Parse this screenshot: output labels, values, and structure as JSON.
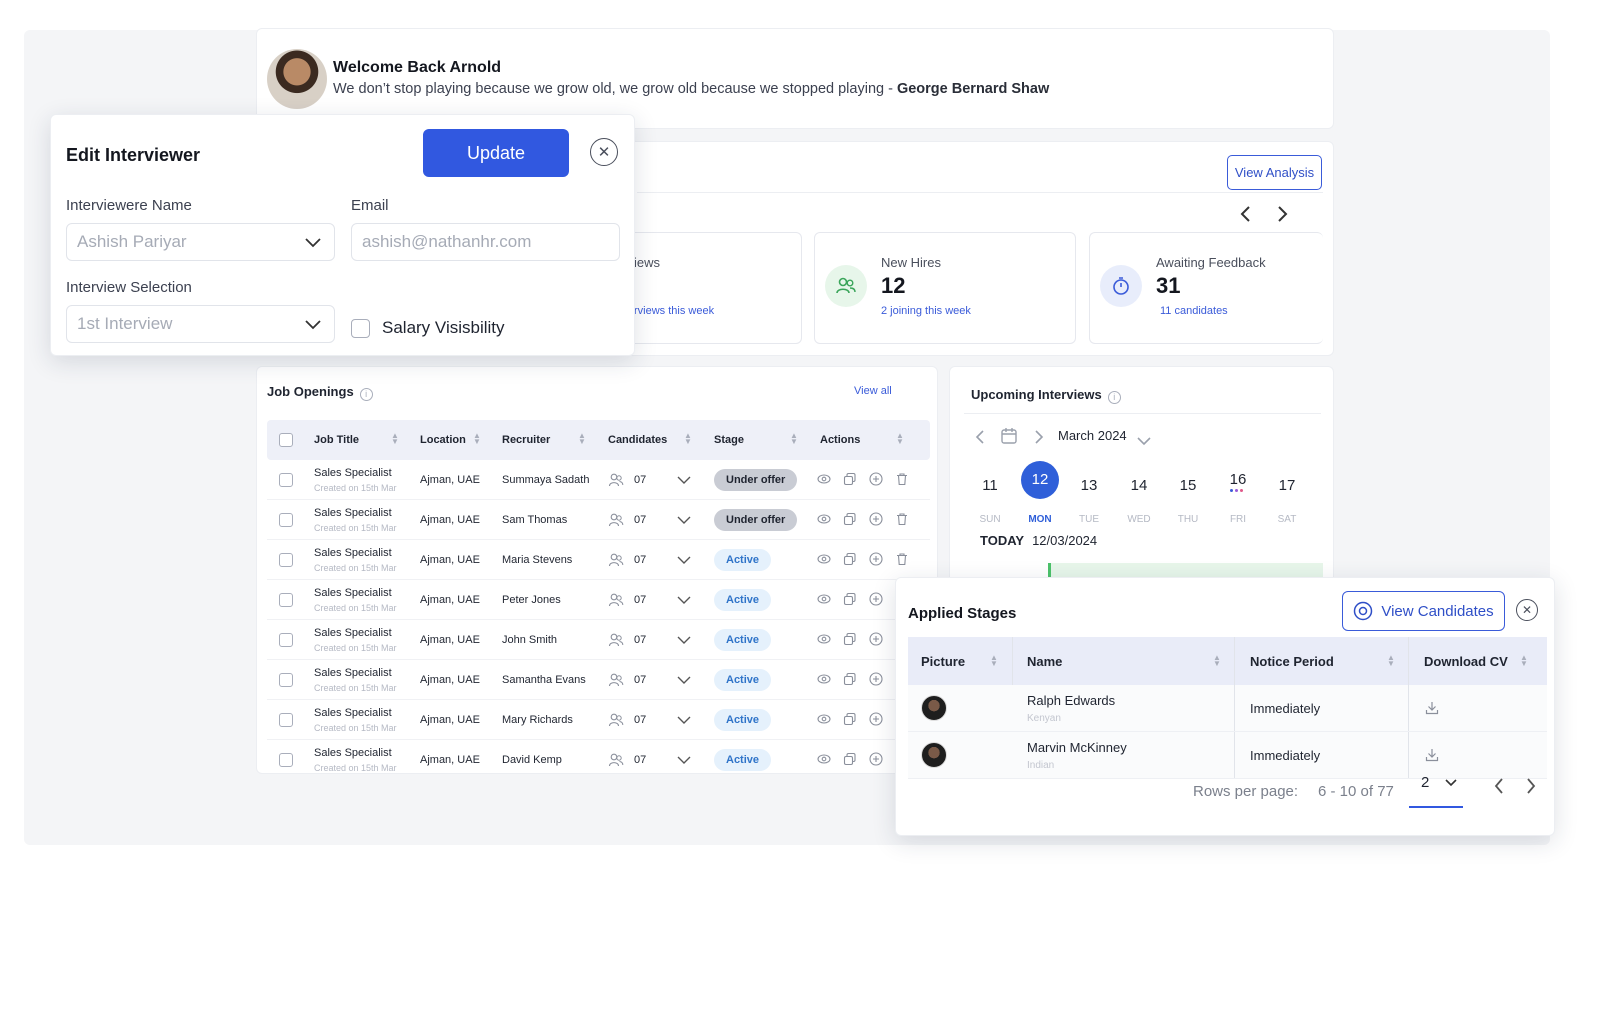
{
  "welcome": {
    "title": "Welcome Back Arnold",
    "quote": "We don’t stop playing because we grow old, we grow old because we stopped playing - ",
    "quote_author": "George Bernard Shaw"
  },
  "stats": {
    "view_analysis_label": "View Analysis",
    "cards": [
      {
        "label": "iews",
        "value": "",
        "sub": "rviews this week",
        "icon": "calendar-icon"
      },
      {
        "label": "New Hires",
        "value": "12",
        "sub": "2 joining this week",
        "icon": "users-icon"
      },
      {
        "label": "Awaiting Feedback",
        "value": "31",
        "sub": "11 candidates",
        "icon": "stopwatch-icon"
      }
    ]
  },
  "jobs": {
    "title": "Job Openings",
    "view_all": "View all",
    "headers": [
      "Job Title",
      "Location",
      "Recruiter",
      "Candidates",
      "Stage",
      "Actions"
    ],
    "rows": [
      {
        "title": "Sales Specialist",
        "created": "Created on 15th Mar",
        "location": "Ajman, UAE",
        "recruiter": "Summaya Sadath",
        "candidates": "07",
        "stage": "Under offer"
      },
      {
        "title": "Sales Specialist",
        "created": "Created on 15th Mar",
        "location": "Ajman, UAE",
        "recruiter": "Sam Thomas",
        "candidates": "07",
        "stage": "Under offer"
      },
      {
        "title": "Sales Specialist",
        "created": "Created on 15th Mar",
        "location": "Ajman, UAE",
        "recruiter": "Maria Stevens",
        "candidates": "07",
        "stage": "Active"
      },
      {
        "title": "Sales Specialist",
        "created": "Created on 15th Mar",
        "location": "Ajman, UAE",
        "recruiter": "Peter Jones",
        "candidates": "07",
        "stage": "Active"
      },
      {
        "title": "Sales Specialist",
        "created": "Created on 15th Mar",
        "location": "Ajman, UAE",
        "recruiter": "John Smith",
        "candidates": "07",
        "stage": "Active"
      },
      {
        "title": "Sales Specialist",
        "created": "Created on 15th Mar",
        "location": "Ajman, UAE",
        "recruiter": "Samantha Evans",
        "candidates": "07",
        "stage": "Active"
      },
      {
        "title": "Sales Specialist",
        "created": "Created on 15th Mar",
        "location": "Ajman, UAE",
        "recruiter": "Mary Richards",
        "candidates": "07",
        "stage": "Active"
      },
      {
        "title": "Sales Specialist",
        "created": "Created on 15th Mar",
        "location": "Ajman, UAE",
        "recruiter": "David Kemp",
        "candidates": "07",
        "stage": "Active"
      }
    ]
  },
  "interviews": {
    "title": "Upcoming Interviews",
    "month": "March 2024",
    "days": [
      {
        "num": "11",
        "name": "SUN"
      },
      {
        "num": "12",
        "name": "MON"
      },
      {
        "num": "13",
        "name": "TUE"
      },
      {
        "num": "14",
        "name": "WED"
      },
      {
        "num": "15",
        "name": "THU"
      },
      {
        "num": "16",
        "name": "FRI"
      },
      {
        "num": "17",
        "name": "SAT"
      }
    ],
    "today_label": "TODAY",
    "today_date": "12/03/2024"
  },
  "edit": {
    "title": "Edit Interviewer",
    "update_label": "Update",
    "name_label": "Interviewere Name",
    "name_value": "Ashish Pariyar",
    "email_label": "Email",
    "email_value": "ashish@nathanhr.com",
    "selection_label": "Interview Selection",
    "selection_value": "1st Interview",
    "salary_label": "Salary Visisbility"
  },
  "applied": {
    "title": "Applied Stages",
    "view_candidates_label": "View Candidates",
    "headers": [
      "Picture",
      "Name",
      "Notice Period",
      "Download CV"
    ],
    "rows": [
      {
        "name": "Ralph Edwards",
        "origin": "Kenyan",
        "notice": "Immediately"
      },
      {
        "name": "Marvin McKinney",
        "origin": "Indian",
        "notice": "Immediately"
      }
    ],
    "rows_per_page_label": "Rows per page:",
    "range": "6 - 10 of 77",
    "page": "2"
  },
  "colors": {
    "accent": "#3158e0",
    "active_badge": "#e5f1fc",
    "offer_badge": "#c9ccd4"
  }
}
